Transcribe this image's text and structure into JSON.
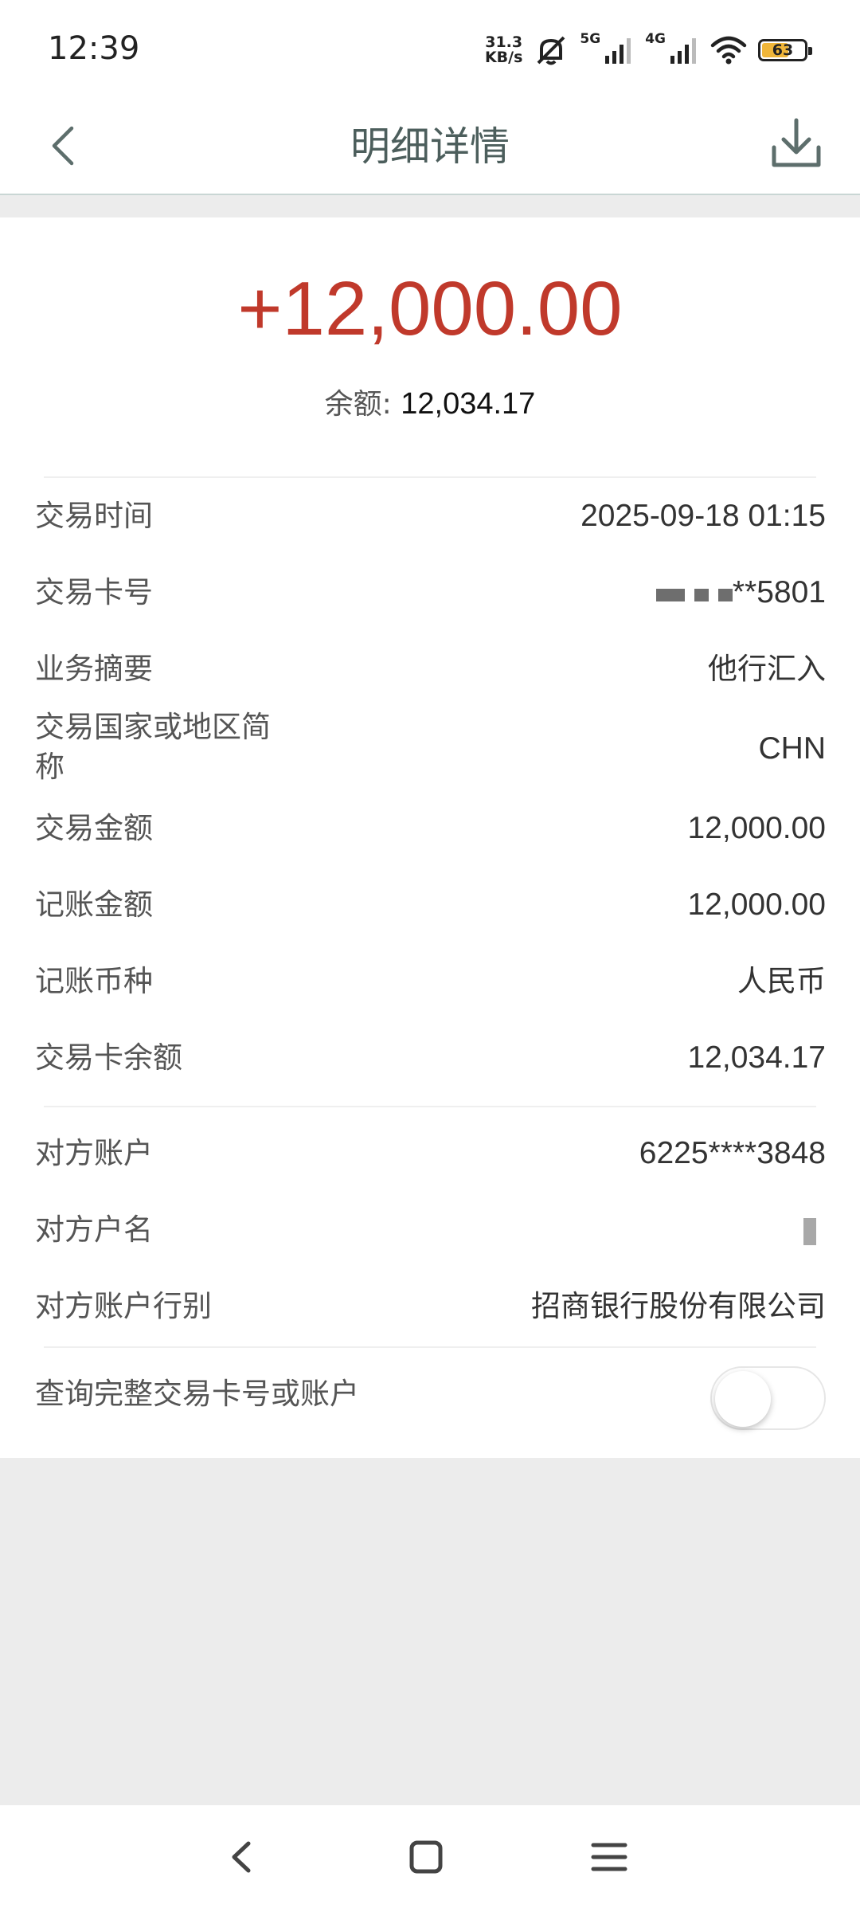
{
  "status_bar": {
    "time": "12:39",
    "net_speed_value": "31.3",
    "net_speed_unit": "KB/s",
    "net_5g": "5G",
    "net_4g": "4G",
    "battery_level": "63",
    "battery_color": "#f0b63a"
  },
  "header": {
    "title": "明细详情",
    "back_icon": "chevron-left-icon",
    "download_icon": "download-icon"
  },
  "summary": {
    "amount": "+12,000.00",
    "amount_color": "#c0392b",
    "balance_label": "余额: ",
    "balance_value": "12,034.17"
  },
  "details": [
    {
      "label": "交易时间",
      "value": "2025-09-18 01:15"
    },
    {
      "label": "交易卡号",
      "value": "**5801"
    },
    {
      "label": "业务摘要",
      "value": "他行汇入"
    },
    {
      "label_line1": "交易国家或地区简",
      "label_line2": "称",
      "value": "CHN"
    },
    {
      "label": "交易金额",
      "value": "12,000.00"
    },
    {
      "label": "记账金额",
      "value": "12,000.00"
    },
    {
      "label": "记账币种",
      "value": "人民币"
    },
    {
      "label": "交易卡余额",
      "value": "12,034.17"
    }
  ],
  "counterparty": [
    {
      "label": "对方账户",
      "value": "6225****3848"
    },
    {
      "label": "对方户名",
      "value": ""
    },
    {
      "label": "对方账户行别",
      "value": "招商银行股份有限公司"
    }
  ],
  "toggle": {
    "label": "查询完整交易卡号或账户",
    "state": "off"
  },
  "nav_bar": {
    "back_icon": "triangle-back-icon",
    "home_icon": "square-home-icon",
    "menu_icon": "menu-icon"
  }
}
